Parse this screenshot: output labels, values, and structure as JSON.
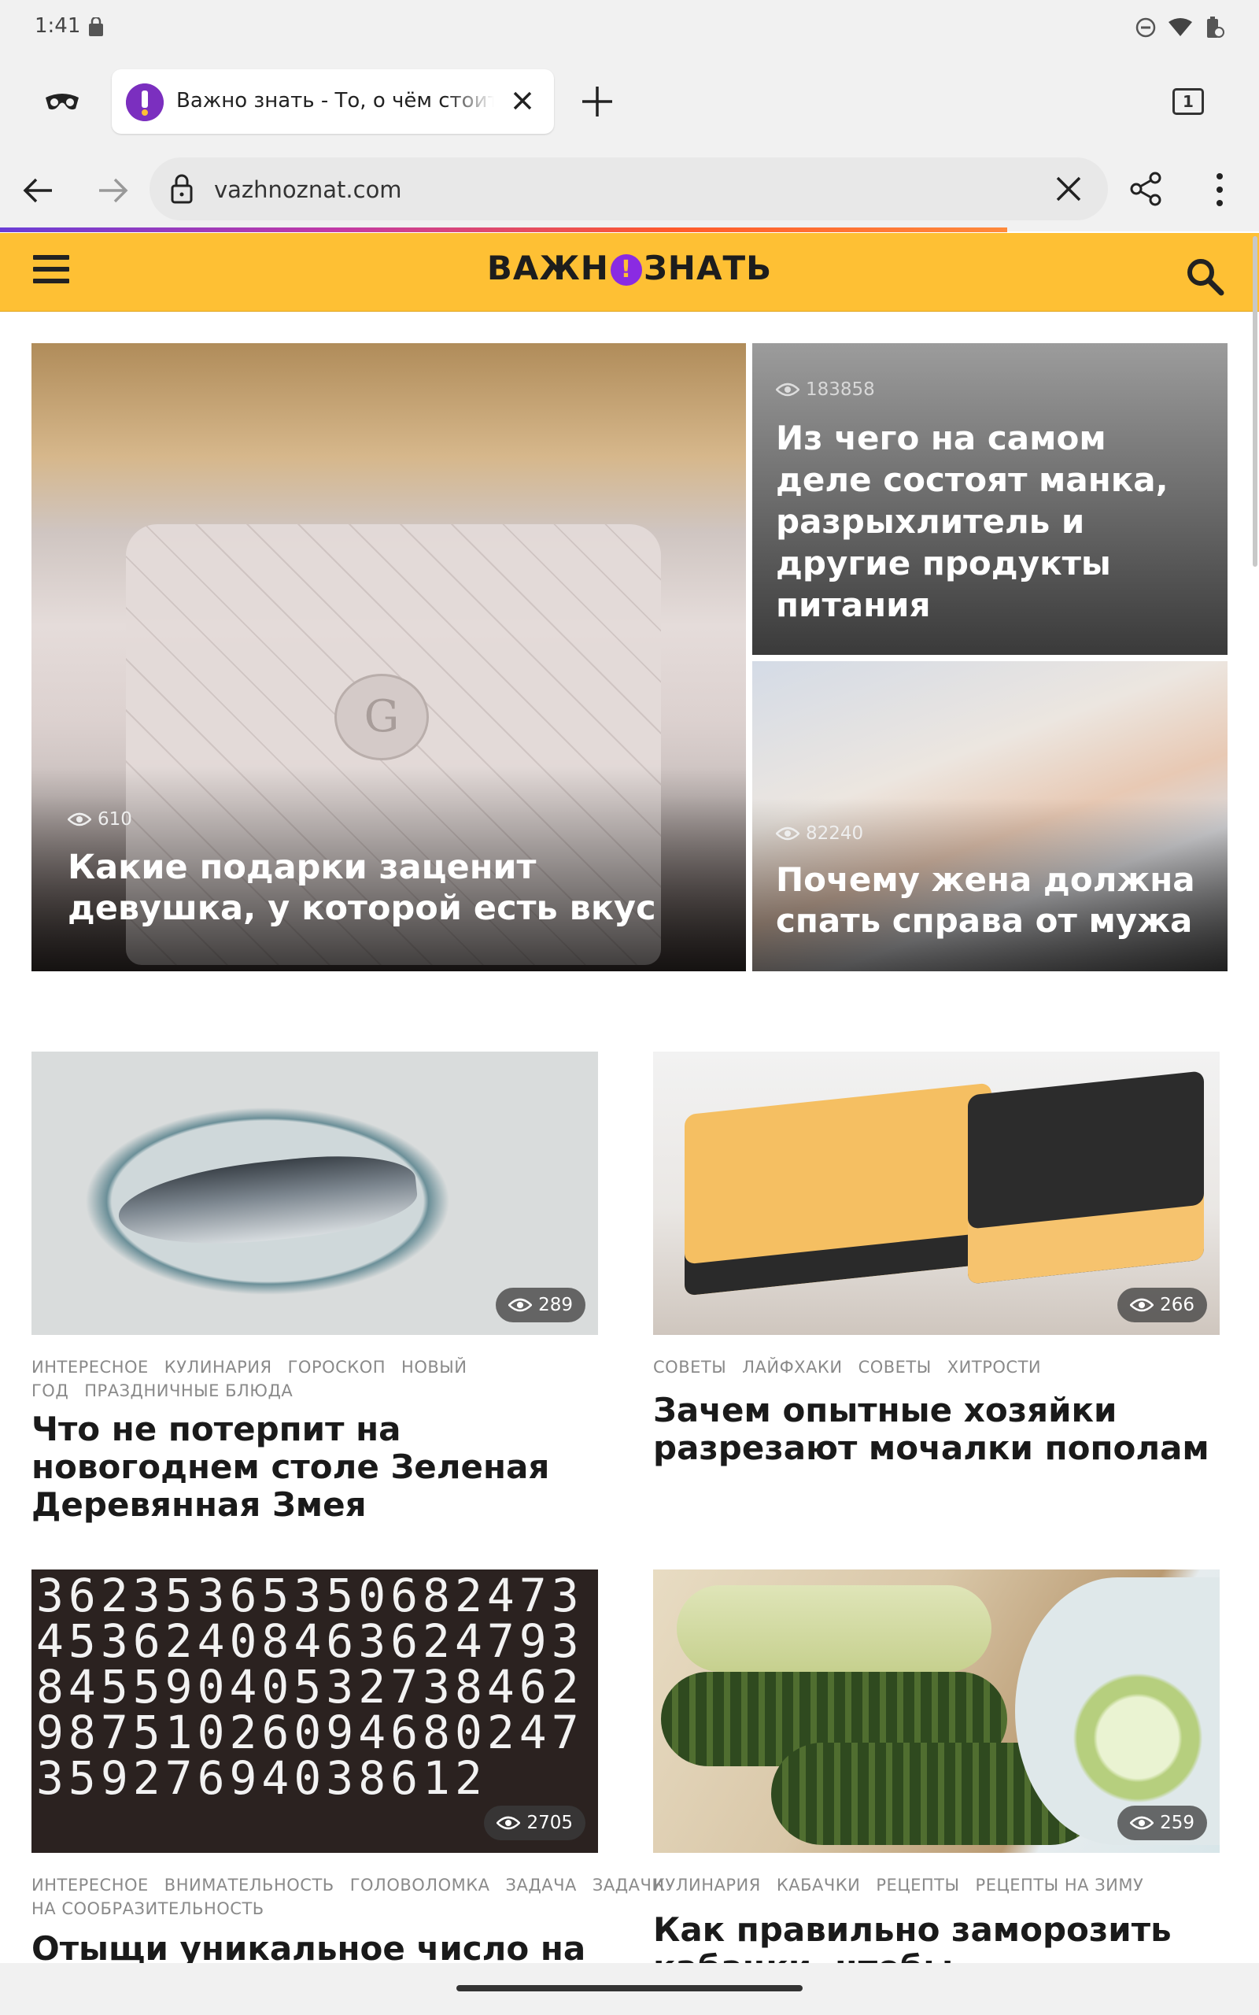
{
  "status_bar": {
    "time": "1:41"
  },
  "browser": {
    "tab": {
      "title": "Важно знать - То, о чём стоит знать"
    },
    "tab_count": "1",
    "url": "vazhnoznat.com",
    "page_load_progress": 0.8
  },
  "site": {
    "logo_left": "ВАЖН",
    "logo_mark": "!",
    "logo_right": "ЗНАТЬ",
    "brand_color": "#fec034"
  },
  "hero": [
    {
      "views": "610",
      "title": "Какие подарки заценит девушка, у которой есть вкус"
    },
    {
      "views": "183858",
      "title": "Из чего на самом деле состоят манка, разрыхлитель и другие продукты питания"
    },
    {
      "views": "82240",
      "title": "Почему жена должна спать справа от мужа"
    }
  ],
  "cards": [
    {
      "views": "289",
      "tags": [
        "Интересное",
        "Кулинария",
        "Гороскоп",
        "Новый год",
        "Праздничные блюда"
      ],
      "title": "Что не потерпит на новогоднем столе Зеленая Деревянная Змея"
    },
    {
      "views": "266",
      "tags": [
        "Советы",
        "Лайфхаки",
        "Советы",
        "Хитрости"
      ],
      "title": "Зачем опытные хозяйки разрезают мочалки пополам"
    },
    {
      "views": "2705",
      "tags": [
        "Интересное",
        "Внимательность",
        "Головоломка",
        "Задача",
        "Задачи на сообразительность"
      ],
      "title": "Отыщи уникальное число на"
    },
    {
      "views": "259",
      "tags": [
        "Кулинария",
        "Кабачки",
        "Рецепты",
        "Рецепты на зиму"
      ],
      "title": "Как правильно заморозить кабачки, чтобы наслаждаться"
    }
  ],
  "numbers_pattern": "3623536535068247345362408463624793845590405327384629875102609468024735927694038612"
}
